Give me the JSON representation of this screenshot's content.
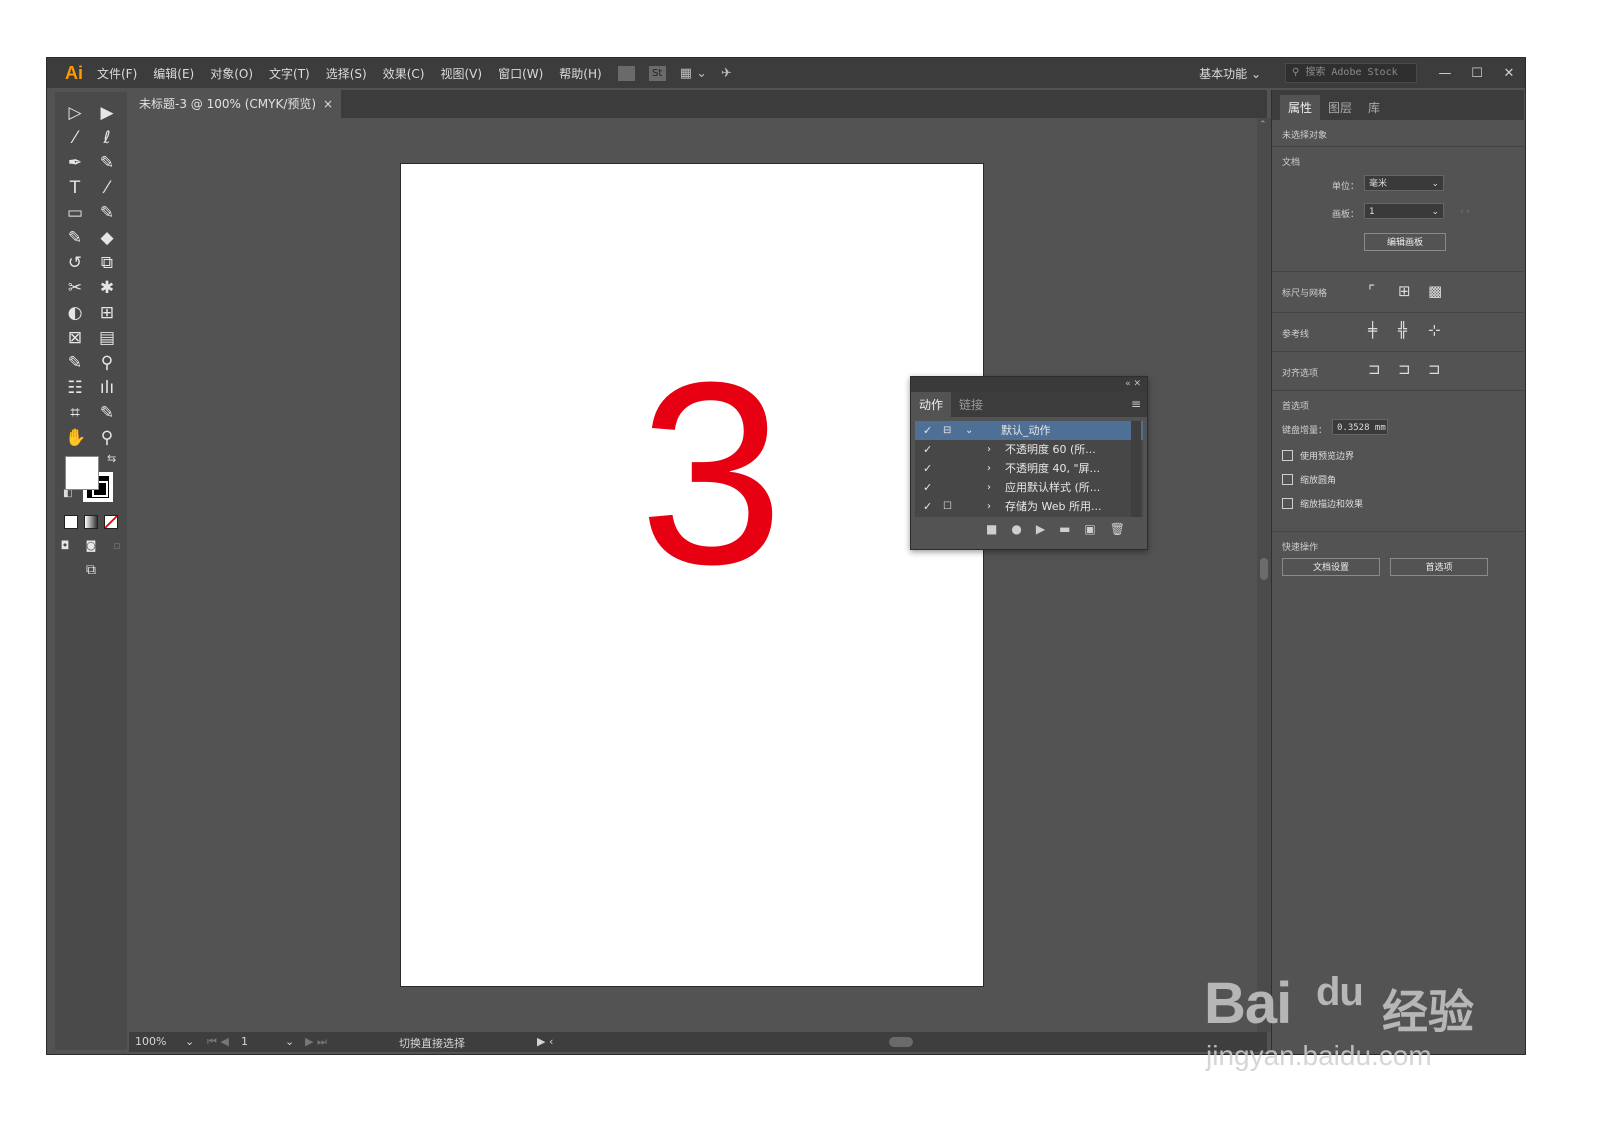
{
  "menubar": {
    "app_logo": "Ai",
    "items": [
      "文件(F)",
      "编辑(E)",
      "对象(O)",
      "文字(T)",
      "选择(S)",
      "效果(C)",
      "视图(V)",
      "窗口(W)",
      "帮助(H)"
    ],
    "icons": [
      "bridge-icon",
      "stock-icon",
      "arrange-documents-icon",
      "gpu-icon"
    ],
    "st_label": "St",
    "workspace": "基本功能 ⌄",
    "search_placeholder": "搜索 Adobe Stock",
    "window_controls": [
      "—",
      "☐",
      "✕"
    ]
  },
  "document": {
    "tab_title": "未标题-3 @ 100% (CMYK/预览)",
    "close": "×",
    "artboard_text": "3",
    "artboard_text_color": "#e60012"
  },
  "statusbar": {
    "zoom": "100%",
    "artboard_number": "1",
    "tool_hint": "切换直接选择"
  },
  "toolbox": {
    "tools": [
      [
        "selection-tool",
        "direct-selection-tool"
      ],
      [
        "magic-wand-tool",
        "lasso-tool"
      ],
      [
        "pen-tool",
        "curvature-tool"
      ],
      [
        "type-tool",
        "line-tool"
      ],
      [
        "rectangle-tool",
        "paintbrush-tool"
      ],
      [
        "shaper-tool",
        "eraser-tool"
      ],
      [
        "rotate-tool",
        "scale-tool"
      ],
      [
        "warp-tool",
        "puppet-warp-tool"
      ],
      [
        "shape-builder-tool",
        "perspective-grid-tool"
      ],
      [
        "mesh-tool",
        "gradient-tool"
      ],
      [
        "eyedropper-tool",
        "blend-tool"
      ],
      [
        "symbol-sprayer-tool",
        "column-graph-tool"
      ],
      [
        "artboard-tool",
        "slice-tool"
      ],
      [
        "hand-tool",
        "zoom-tool"
      ]
    ],
    "glyphs": [
      [
        "▷",
        "▶"
      ],
      [
        "⁄",
        "ℓ"
      ],
      [
        "✒",
        "✎"
      ],
      [
        "T",
        "⁄"
      ],
      [
        "▭",
        "✎"
      ],
      [
        "✎",
        "◆"
      ],
      [
        "↺",
        "⧉"
      ],
      [
        "✂",
        "✱"
      ],
      [
        "◐",
        "⊞"
      ],
      [
        "⊠",
        "▤"
      ],
      [
        "✎",
        "⚲"
      ],
      [
        "☷",
        "ılı"
      ],
      [
        "⌗",
        "✎"
      ],
      [
        "✋",
        "⚲"
      ]
    ]
  },
  "actions_panel": {
    "tabs": [
      "动作",
      "链接"
    ],
    "rows": [
      {
        "check": "✓",
        "box": "⊟",
        "twirl": "⌄",
        "label": "默认_动作",
        "selected": true
      },
      {
        "check": "✓",
        "box": "",
        "twirl": "›",
        "label": "不透明度 60 (所...",
        "selected": false
      },
      {
        "check": "✓",
        "box": "",
        "twirl": "›",
        "label": "不透明度 40, \"屏...",
        "selected": false
      },
      {
        "check": "✓",
        "box": "",
        "twirl": "›",
        "label": "应用默认样式 (所...",
        "selected": false
      },
      {
        "check": "✓",
        "box": "☐",
        "twirl": "›",
        "label": "存储为 Web 所用...",
        "selected": false
      }
    ],
    "footer_icons": [
      "stop-icon",
      "record-icon",
      "play-icon",
      "new-set-icon",
      "new-action-icon",
      "delete-icon"
    ],
    "footer_glyphs": [
      "■",
      "●",
      "▶",
      "▬",
      "▣",
      "🗑"
    ]
  },
  "properties_panel": {
    "tabs": [
      "属性",
      "图层",
      "库"
    ],
    "no_selection": "未选择对象",
    "document_label": "文档",
    "units_label": "单位：",
    "units_value": "毫米",
    "artboard_label": "画板：",
    "artboard_value": "1",
    "edit_artboards": "编辑画板",
    "rulers_grids": "标尺与网格",
    "guides": "参考线",
    "snap_options": "对齐选项",
    "preferences": "首选项",
    "keyboard_increment_label": "键盘增量：",
    "keyboard_increment_value": "0.3528 mm",
    "checkboxes": [
      "使用预览边界",
      "缩放圆角",
      "缩放描边和效果"
    ],
    "quick_actions": "快速操作",
    "doc_setup_button": "文档设置",
    "preferences_button": "首选项"
  },
  "watermark": {
    "main": "Bai",
    "paw": "du",
    "chinese": "经验",
    "url": "jingyan.baidu.com"
  }
}
